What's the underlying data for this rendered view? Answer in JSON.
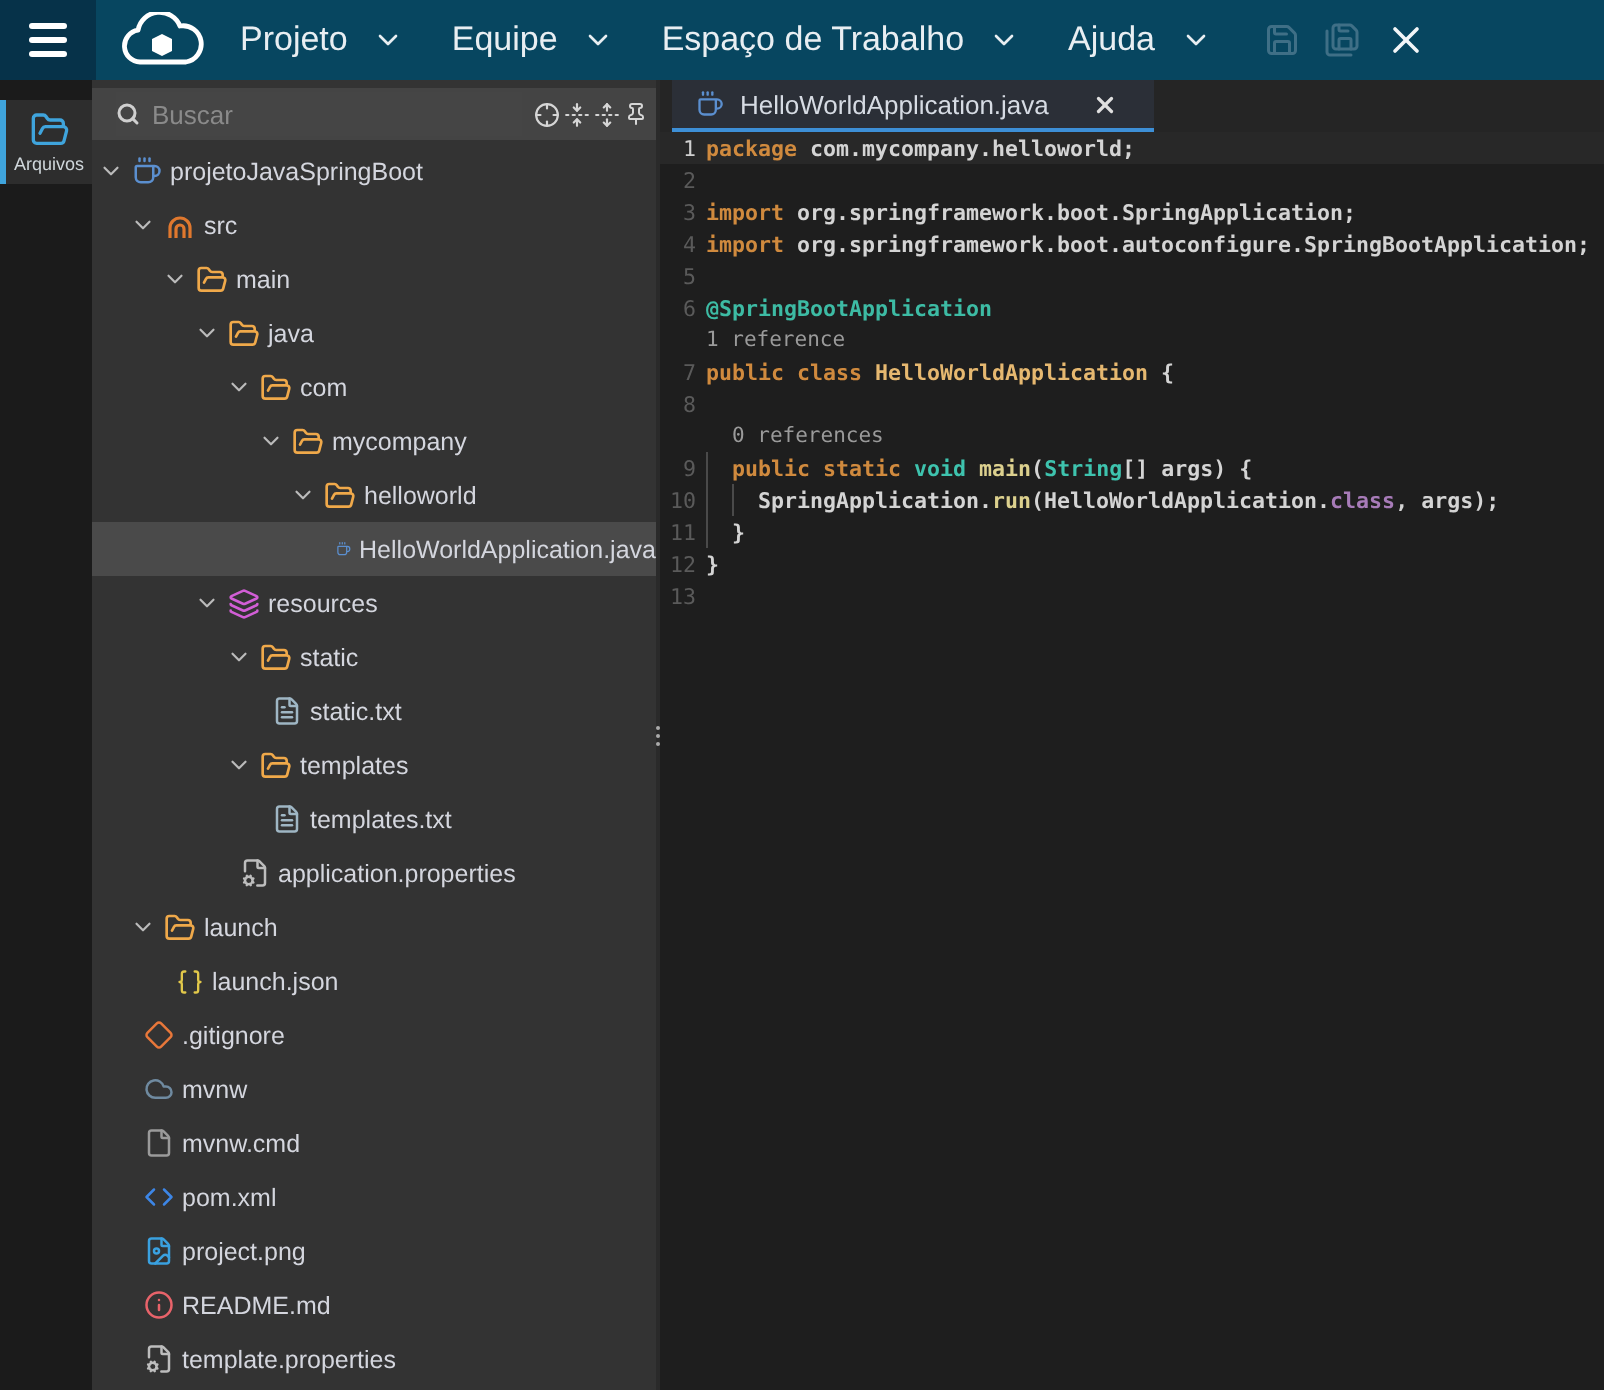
{
  "menu_bar": {
    "items": [
      {
        "label": "Projeto"
      },
      {
        "label": "Equipe"
      },
      {
        "label": "Espaço de Trabalho"
      },
      {
        "label": "Ajuda"
      }
    ],
    "actions": [
      {
        "kind": "save",
        "disabled": true
      },
      {
        "kind": "save_all",
        "disabled": true
      },
      {
        "kind": "close",
        "disabled": false
      }
    ]
  },
  "activity_bar": {
    "items": [
      {
        "label": "Arquivos",
        "selected": true
      }
    ]
  },
  "explorer": {
    "search": {
      "placeholder": "Buscar"
    },
    "tree": [
      {
        "label": "projetoJavaSpringBoot",
        "kind": "java",
        "expanded": true,
        "selected": false,
        "children": [
          {
            "label": "src",
            "kind": "src",
            "expanded": true,
            "selected": false,
            "children": [
              {
                "label": "main",
                "kind": "folder",
                "expanded": true,
                "selected": false,
                "children": [
                  {
                    "label": "java",
                    "kind": "folder",
                    "expanded": true,
                    "selected": false,
                    "children": [
                      {
                        "label": "com",
                        "kind": "folder",
                        "expanded": true,
                        "selected": false,
                        "children": [
                          {
                            "label": "mycompany",
                            "kind": "folder",
                            "expanded": true,
                            "selected": false,
                            "children": [
                              {
                                "label": "helloworld",
                                "kind": "folder",
                                "expanded": true,
                                "selected": false,
                                "children": [
                                  {
                                    "label": "HelloWorldApplication.java",
                                    "kind": "java",
                                    "selected": true
                                  }
                                ]
                              }
                            ]
                          }
                        ]
                      }
                    ]
                  },
                  {
                    "label": "resources",
                    "kind": "resources",
                    "expanded": true,
                    "selected": false,
                    "children": [
                      {
                        "label": "static",
                        "kind": "folder",
                        "expanded": true,
                        "selected": false,
                        "children": [
                          {
                            "label": "static.txt",
                            "kind": "text",
                            "selected": false
                          }
                        ]
                      },
                      {
                        "label": "templates",
                        "kind": "folder",
                        "expanded": true,
                        "selected": false,
                        "children": [
                          {
                            "label": "templates.txt",
                            "kind": "text",
                            "selected": false
                          }
                        ]
                      },
                      {
                        "label": "application.properties",
                        "kind": "properties",
                        "selected": false
                      }
                    ]
                  }
                ]
              }
            ]
          },
          {
            "label": "launch",
            "kind": "folder",
            "expanded": true,
            "selected": false,
            "children": [
              {
                "label": "launch.json",
                "kind": "json",
                "selected": false
              }
            ]
          },
          {
            "label": ".gitignore",
            "kind": "git",
            "selected": false
          },
          {
            "label": "mvnw",
            "kind": "cloud",
            "selected": false
          },
          {
            "label": "mvnw.cmd",
            "kind": "unknown",
            "selected": false
          },
          {
            "label": "pom.xml",
            "kind": "xml",
            "selected": false
          },
          {
            "label": "project.png",
            "kind": "image",
            "selected": false
          },
          {
            "label": "README.md",
            "kind": "info",
            "selected": false
          },
          {
            "label": "template.properties",
            "kind": "properties",
            "selected": false
          }
        ]
      }
    ]
  },
  "editor": {
    "tabs": [
      {
        "label": "HelloWorldApplication.java",
        "selected": true
      }
    ],
    "lines": [
      {
        "kind": "code",
        "number": "1",
        "current": true,
        "tokens": [
          {
            "text": "package ",
            "kind": "keyword"
          },
          {
            "text": "com.mycompany.helloworld;",
            "kind": "plain"
          }
        ]
      },
      {
        "kind": "code",
        "number": "2",
        "current": false
      },
      {
        "kind": "code",
        "number": "3",
        "current": false,
        "tokens": [
          {
            "text": "import ",
            "kind": "keyword"
          },
          {
            "text": "org.springframework.boot.SpringApplication;",
            "kind": "plain"
          }
        ]
      },
      {
        "kind": "code",
        "number": "4",
        "current": false,
        "tokens": [
          {
            "text": "import ",
            "kind": "keyword"
          },
          {
            "text": "org.springframework.boot.autoconfigure.SpringBootApplication;",
            "kind": "plain"
          }
        ]
      },
      {
        "kind": "code",
        "number": "5",
        "current": false
      },
      {
        "kind": "code",
        "number": "6",
        "current": false,
        "tokens": [
          {
            "text": "@SpringBootApplication",
            "kind": "annotation"
          }
        ]
      },
      {
        "kind": "lens",
        "text": "1 reference"
      },
      {
        "kind": "code",
        "number": "7",
        "current": false,
        "tokens": [
          {
            "text": "public class ",
            "kind": "keyword"
          },
          {
            "text": "HelloWorldApplication",
            "kind": "classname"
          },
          {
            "text": " {",
            "kind": "plain"
          }
        ]
      },
      {
        "kind": "code",
        "number": "8",
        "current": false
      },
      {
        "kind": "lens",
        "text": "0 references"
      },
      {
        "kind": "code",
        "number": "9",
        "current": false,
        "tokens": [
          {
            "text": "  public static ",
            "kind": "keyword"
          },
          {
            "text": "void ",
            "kind": "type"
          },
          {
            "text": "main",
            "kind": "function"
          },
          {
            "text": "(",
            "kind": "plain"
          },
          {
            "text": "String",
            "kind": "type"
          },
          {
            "text": "[] args) {",
            "kind": "plain"
          }
        ]
      },
      {
        "kind": "code",
        "number": "10",
        "current": false,
        "tokens": [
          {
            "text": "    SpringApplication.",
            "kind": "plain"
          },
          {
            "text": "run",
            "kind": "function"
          },
          {
            "text": "(HelloWorldApplication.",
            "kind": "plain"
          },
          {
            "text": "class",
            "kind": "special"
          },
          {
            "text": ", args);",
            "kind": "plain"
          }
        ]
      },
      {
        "kind": "code",
        "number": "11",
        "current": false,
        "tokens": [
          {
            "text": "  }",
            "kind": "plain"
          }
        ]
      },
      {
        "kind": "code",
        "number": "12",
        "current": false,
        "tokens": [
          {
            "text": "}",
            "kind": "plain"
          }
        ]
      },
      {
        "kind": "code",
        "number": "13",
        "current": false
      }
    ]
  }
}
